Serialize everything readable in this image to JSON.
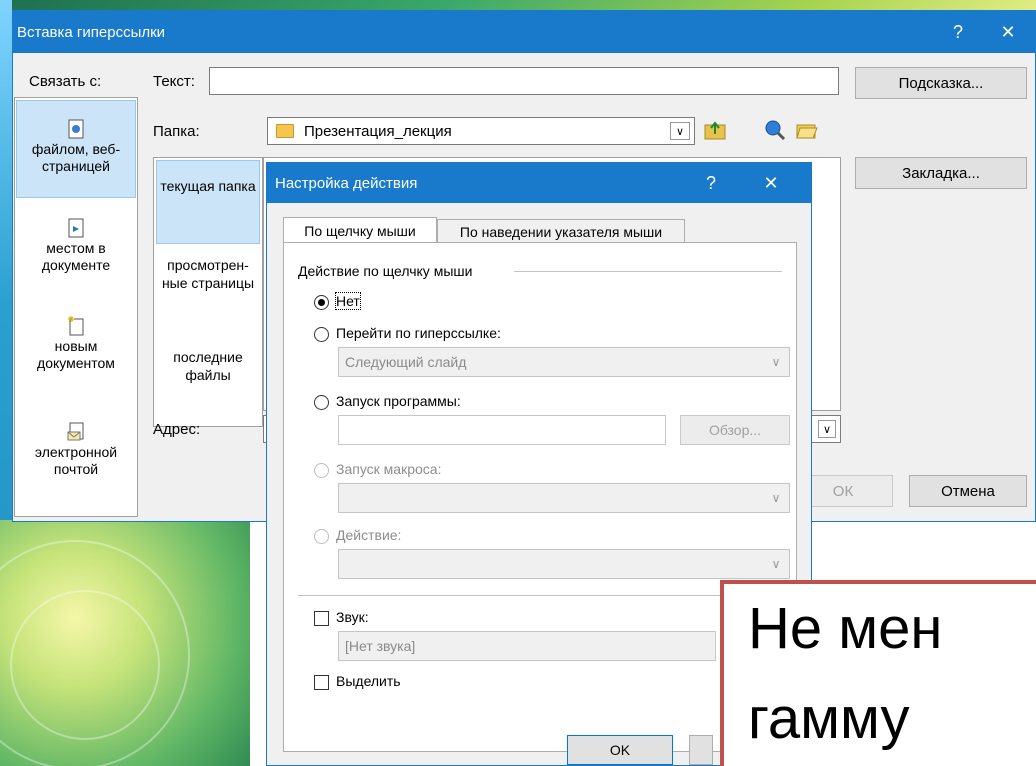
{
  "outer_dialog": {
    "title": "Вставка гиперссылки",
    "help_button": "?",
    "close_button": "✕",
    "link_with_label": "Связать с:",
    "text_label": "Текст:",
    "text_value": "",
    "tooltip_button": "Подсказка...",
    "folder_label": "Папка:",
    "folder_value": "Презентация_лекция",
    "bookmark_button": "Закладка...",
    "address_label": "Адрес:",
    "ok_button": "ОК",
    "cancel_button": "Отмена",
    "link_types": [
      {
        "label": "файлом, веб-страницей",
        "icon": "page-icon",
        "selected": true
      },
      {
        "label": "местом в документе",
        "icon": "document-place-icon",
        "selected": false
      },
      {
        "label": "новым документом",
        "icon": "new-document-icon",
        "selected": false
      },
      {
        "label": "электронной почтой",
        "icon": "email-icon",
        "selected": false
      }
    ],
    "sub_nav": [
      {
        "label": "текущая папка",
        "selected": true
      },
      {
        "label": "просмотрен-ные страницы",
        "selected": false
      },
      {
        "label": "последние файлы",
        "selected": false
      }
    ]
  },
  "inner_dialog": {
    "title": "Настройка действия",
    "help_button": "?",
    "close_button": "✕",
    "tabs": [
      "По щелчку мыши",
      "По наведении указателя мыши"
    ],
    "group_label": "Действие по щелчку мыши",
    "options": {
      "none": "Нет",
      "hyperlink": "Перейти по гиперссылке:",
      "hyperlink_value": "Следующий слайд",
      "run_program": "Запуск программы:",
      "browse_button": "Обзор...",
      "run_macro": "Запуск макроса:",
      "action": "Действие:"
    },
    "sound_label": "Звук:",
    "sound_value": "[Нет звука]",
    "highlight_label": "Выделить",
    "ok_button": "OK"
  },
  "slide_text": "Не мен",
  "slide_text_line2": "гамму",
  "colors": {
    "title_bar": "#1979ca",
    "selection": "#cce4f7",
    "note_border": "#c0504d"
  }
}
